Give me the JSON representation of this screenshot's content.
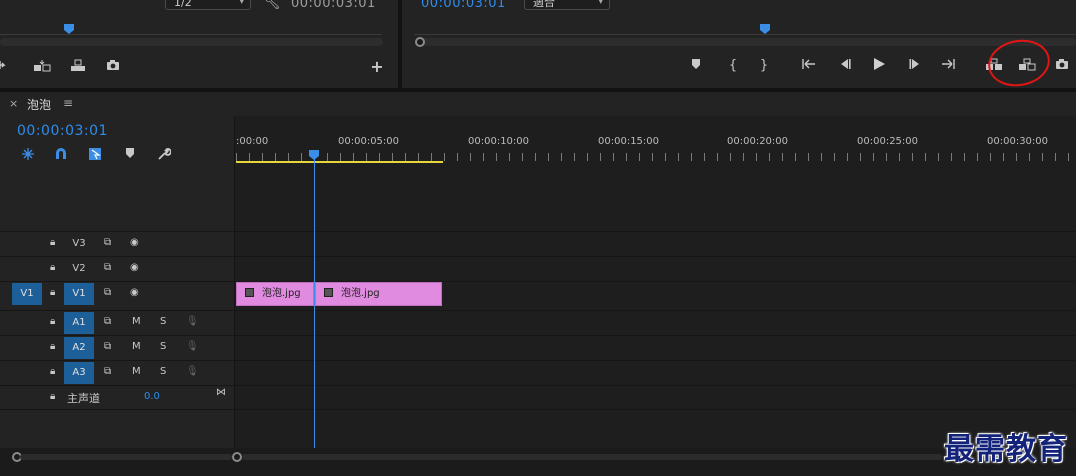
{
  "source_monitor": {
    "zoom_value": "1/2",
    "timecode": "00:00:03:01"
  },
  "program_monitor": {
    "timecode": "00:00:03:01",
    "fit_value": "適合"
  },
  "timeline": {
    "close_label": "×",
    "sequence_name": "泡泡",
    "menu_label": "≡",
    "current_timecode": "00:00:03:01",
    "ruler_labels": [
      ":00:00",
      "00:00:05:00",
      "00:00:10:00",
      "00:00:15:00",
      "00:00:20:00",
      "00:00:25:00",
      "00:00:30:00"
    ],
    "tracks": {
      "v3": {
        "label": "V3"
      },
      "v2": {
        "label": "V2"
      },
      "v1": {
        "source": "V1",
        "label": "V1"
      },
      "a1": {
        "label": "A1",
        "m": "M",
        "s": "S"
      },
      "a2": {
        "label": "A2",
        "m": "M",
        "s": "S"
      },
      "a3": {
        "label": "A3",
        "m": "M",
        "s": "S"
      },
      "master": {
        "label": "主声道",
        "value": "0.0"
      }
    },
    "clips": [
      {
        "name": "泡泡.jpg"
      },
      {
        "name": "泡泡.jpg"
      }
    ]
  },
  "watermark": "最需教育",
  "colors": {
    "accent_blue": "#2d8ceb",
    "clip_pink": "#e08ae0",
    "work_area": "#e6d63a",
    "annotation": "#e01515"
  }
}
